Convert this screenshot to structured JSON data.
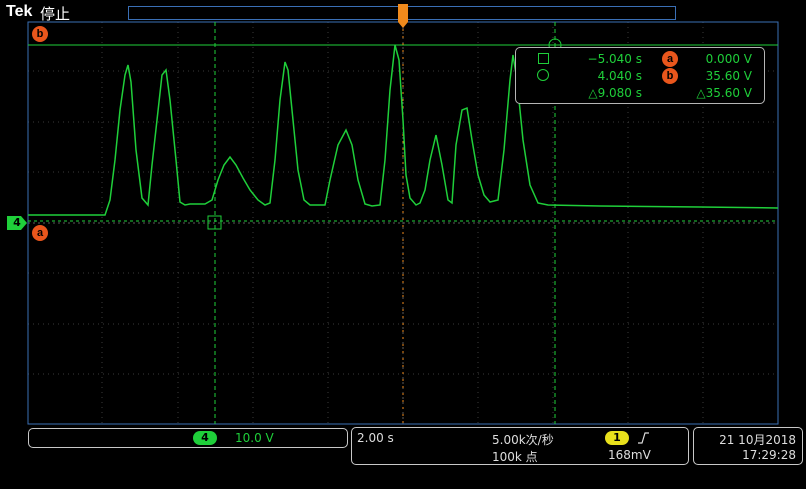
{
  "header": {
    "brand": "Tek",
    "status": "停止",
    "trigger_marker": "T"
  },
  "markers": {
    "ref_b": "b",
    "ref_a": "a",
    "channel": "4"
  },
  "cursor_readout": {
    "row1": {
      "time": "−5.040 s",
      "badge": "a",
      "value": "0.000 V"
    },
    "row2": {
      "time": "4.040 s",
      "badge": "b",
      "value": "35.60 V"
    },
    "row3": {
      "delta_time": "△9.080 s",
      "delta_value": "△35.60 V"
    }
  },
  "footer": {
    "channel_panel": {
      "channel": "4",
      "scale": "10.0 V"
    },
    "timebase": {
      "scale": "2.00 s",
      "sample_rate": "5.00k次/秒",
      "record_length": "100k 点"
    },
    "trigger": {
      "channel": "1",
      "slope_icon": "rising-edge-icon",
      "level": "168mV"
    },
    "datetime": {
      "date": "21 10月2018",
      "time": "17:29:28"
    }
  },
  "colors": {
    "trace": "#1fcf3a",
    "marker": "#e9561c",
    "grid": "#444444",
    "frame": "#3a6fb5"
  }
}
